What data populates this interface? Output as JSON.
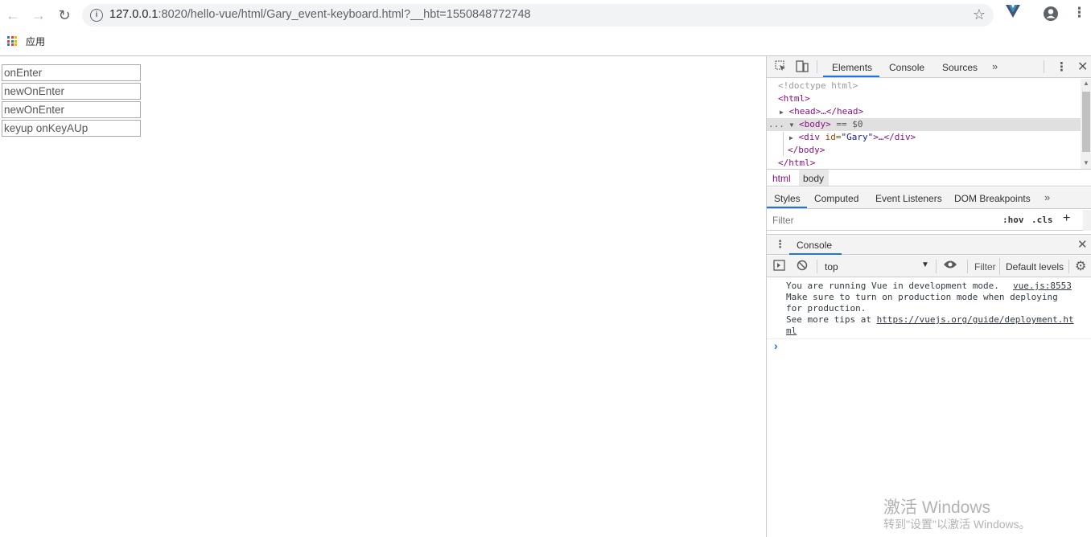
{
  "browser": {
    "url_host": "127.0.0.1",
    "url_rest": ":8020/hello-vue/html/Gary_event-keyboard.html?__hbt=1550848772748",
    "bookmark_apps_label": "应用"
  },
  "page": {
    "inputs": [
      {
        "value": "onEnter"
      },
      {
        "value": "newOnEnter"
      },
      {
        "value": "newOnEnter"
      },
      {
        "value": "keyup onKeyAUp"
      }
    ]
  },
  "devtools": {
    "main_tabs": [
      "Elements",
      "Console",
      "Sources"
    ],
    "dom": {
      "doctype": "<!doctype html>",
      "html_open": "<html>",
      "head": "<head>…</head>",
      "body_open": "<body>",
      "body_marker": " == $0",
      "div_tag": "<div",
      "div_attr": " id=",
      "div_attr_value": "\"Gary\"",
      "div_rest": ">…</div>",
      "body_close": "</body>",
      "html_close": "</html>",
      "ellipsis": "..."
    },
    "breadcrumbs": [
      "html",
      "body"
    ],
    "style_tabs": [
      "Styles",
      "Computed",
      "Event Listeners",
      "DOM Breakpoints"
    ],
    "styles_filter_placeholder": "Filter",
    "hov_label": ":hov",
    "cls_label": ".cls",
    "drawer_tab": "Console",
    "console_context": "top",
    "console_filter_placeholder": "Filter",
    "console_levels": "Default levels",
    "console_messages": [
      "You are running Vue in development mode.",
      "Make sure to turn on production mode when deploying",
      "for production.",
      "See more tips at "
    ],
    "console_source": "vue.js:8553",
    "console_link_line1": "https://vuejs.org/guide/deployment.ht",
    "console_link_line2": "ml",
    "prompt": "›"
  },
  "watermark": {
    "title": "激活 Windows",
    "subtitle": "转到\"设置\"以激活 Windows。"
  }
}
